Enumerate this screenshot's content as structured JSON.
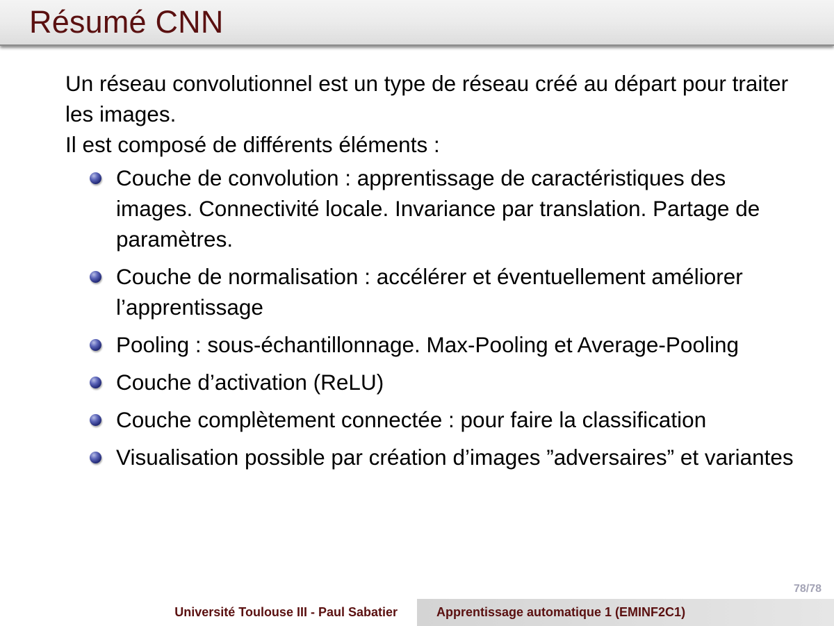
{
  "slide": {
    "title": "Résumé CNN",
    "intro": [
      "Un réseau convolutionnel est un type de réseau créé au départ pour traiter les images.",
      "Il est composé de différents éléments :"
    ],
    "bullets": [
      "Couche de convolution : apprentissage de caractéristiques des images. Connectivité locale. Invariance par translation. Partage de paramètres.",
      "Couche de normalisation : accélérer et éventuellement améliorer l’apprentissage",
      "Pooling : sous-échantillonnage. Max-Pooling et Average-Pooling",
      "Couche d’activation (ReLU)",
      "Couche complètement connectée : pour faire la classification",
      "Visualisation possible par création d’images ”adversaires” et variantes"
    ],
    "page_number": "78/78"
  },
  "footer": {
    "left": "Université Toulouse III - Paul Sabatier",
    "right": "Apprentissage automatique 1 (EMINF2C1)"
  },
  "colors": {
    "title": "#5a1010",
    "bullet": "#1c2370",
    "page_number": "#a3a3b5"
  }
}
